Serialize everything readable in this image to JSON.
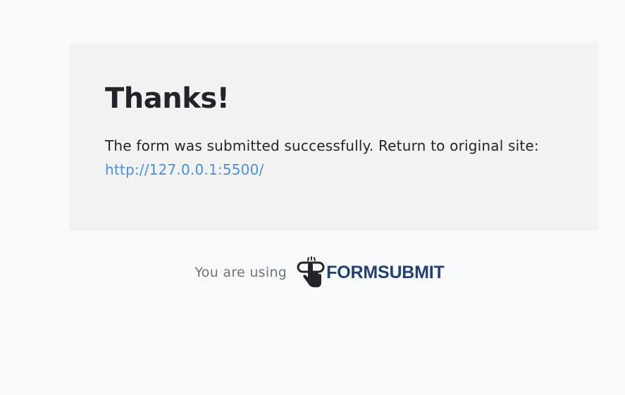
{
  "card": {
    "title": "Thanks!",
    "message": "The form was submitted successfully. Return to original site:",
    "link_text": "http://127.0.0.1:5500/"
  },
  "footer": {
    "text": "You are using",
    "brand_name": "FORMSUBMIT",
    "brand_icon": "hand-click-icon"
  },
  "colors": {
    "background": "#f8f9fa",
    "card": "#f2f2f2",
    "link": "#4a8fd8",
    "brand": "#22416e"
  }
}
